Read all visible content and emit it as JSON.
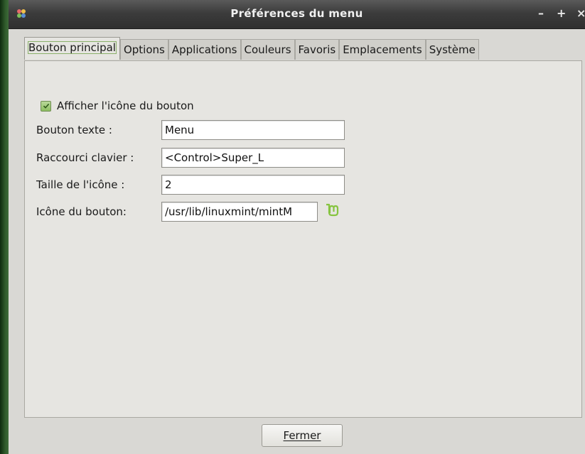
{
  "window": {
    "title": "Préférences du menu",
    "controls": {
      "minimize": "–",
      "maximize": "+",
      "close": "×"
    }
  },
  "tabs": [
    {
      "label": "Bouton principal",
      "active": true
    },
    {
      "label": "Options"
    },
    {
      "label": "Applications"
    },
    {
      "label": "Couleurs"
    },
    {
      "label": "Favoris"
    },
    {
      "label": "Emplacements"
    },
    {
      "label": "Système"
    }
  ],
  "main": {
    "show_icon": {
      "label": "Afficher l'icône du bouton",
      "checked": true
    },
    "fields": {
      "button_text": {
        "label": "Bouton texte :",
        "value": "Menu"
      },
      "shortcut": {
        "label": "Raccourci clavier :",
        "value": "<Control>Super_L"
      },
      "icon_size": {
        "label": "Taille de l'icône :",
        "value": "2"
      },
      "icon_path": {
        "label": "Icône du bouton:",
        "value": "/usr/lib/linuxmint/mintM"
      }
    }
  },
  "footer": {
    "close_label": "Fermer"
  },
  "icons": {
    "app": "menu-prefs-icon",
    "mint": "linuxmint-logo-icon"
  },
  "colors": {
    "accent": "#8ebf62",
    "mint_green": "#86c440"
  }
}
